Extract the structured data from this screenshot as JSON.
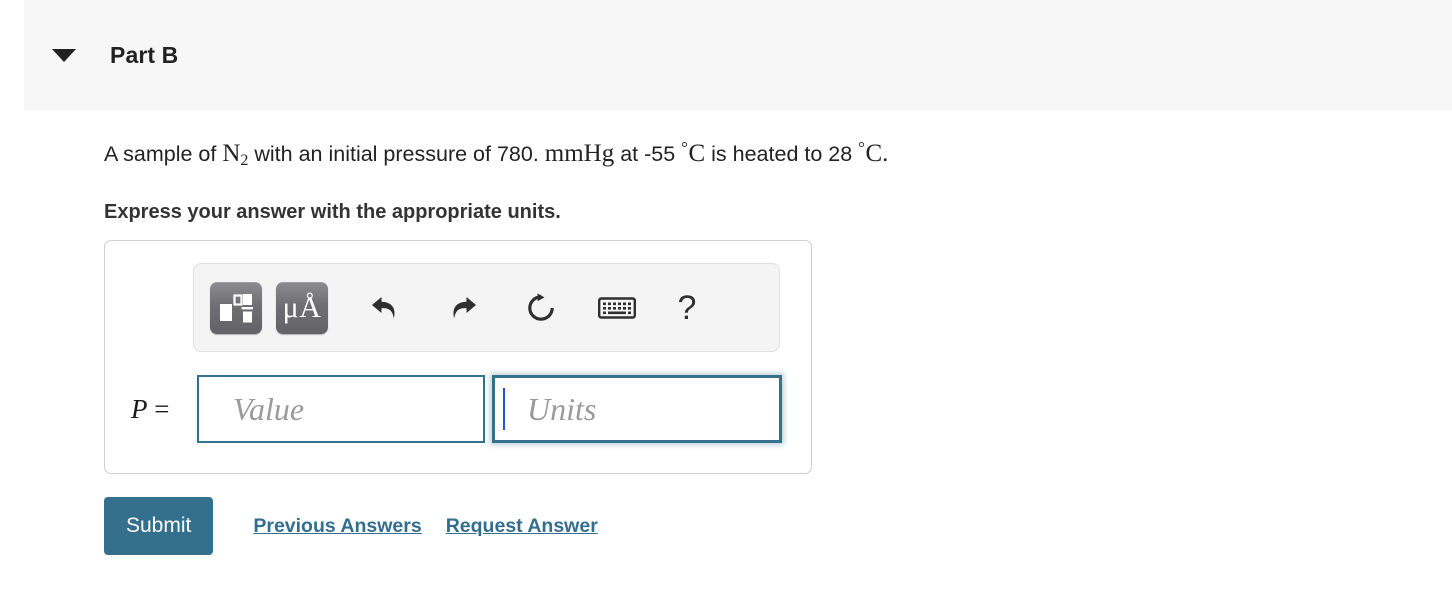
{
  "header": {
    "disclosure_icon": "triangle-down-icon",
    "title": "Part B"
  },
  "question": {
    "seg_1": "A sample of ",
    "formula_element": "N",
    "formula_subscript": "2",
    "seg_2": " with an initial pressure of 780. ",
    "pressure_unit": "mmHg",
    "seg_3": " at -55 ",
    "degree_symbol_1": "°",
    "temp_unit_1": "C",
    "seg_4": " is heated to 28 ",
    "degree_symbol_2": "°",
    "temp_unit_2": "C",
    "seg_5": "."
  },
  "instruction": "Express your answer with the appropriate units.",
  "toolbar": {
    "template_button_name": "math-template-icon",
    "units_button_label": "μÅ",
    "undo_label": "undo-icon",
    "redo_label": "redo-icon",
    "reset_label": "reset-icon",
    "keyboard_label": "keyboard-icon",
    "help_label": "?"
  },
  "answer": {
    "variable_label": "P",
    "equals": "=",
    "value_placeholder": "Value",
    "value_text": "",
    "units_placeholder": "Units",
    "units_text": "",
    "units_focused": true
  },
  "actions": {
    "submit_label": "Submit",
    "previous_answers_label": "Previous Answers",
    "request_answer_label": "Request Answer"
  },
  "colors": {
    "accent": "#336e8e",
    "header_band": "#f7f7f7",
    "field_border": "#35718f",
    "caret": "#2a4fd6",
    "text": "#222222"
  }
}
